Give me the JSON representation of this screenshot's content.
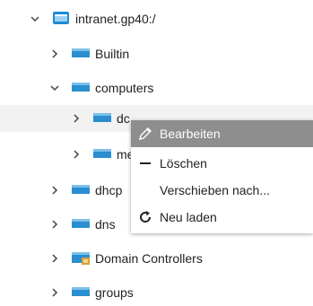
{
  "tree": {
    "root": {
      "label": "intranet.gp40:/",
      "icon": "server-icon"
    },
    "items": [
      {
        "label": "Builtin",
        "icon": "folder-icon"
      },
      {
        "label": "computers",
        "icon": "folder-icon"
      },
      {
        "label": "dc",
        "icon": "folder-icon"
      },
      {
        "label": "me",
        "icon": "folder-icon"
      },
      {
        "label": "dhcp",
        "icon": "folder-icon"
      },
      {
        "label": "dns",
        "icon": "folder-icon"
      },
      {
        "label": "Domain Controllers",
        "icon": "ou-folder-icon"
      },
      {
        "label": "groups",
        "icon": "folder-icon"
      }
    ]
  },
  "context_menu": {
    "items": [
      {
        "label": "Bearbeiten",
        "icon": "pencil-icon"
      },
      {
        "label": "Löschen",
        "icon": "minus-icon"
      },
      {
        "label": "Verschieben nach...",
        "icon": ""
      },
      {
        "label": "Neu laden",
        "icon": "reload-icon"
      }
    ]
  },
  "colors": {
    "folder": "#2a8ed0",
    "menu_highlight": "#8e8e8e",
    "selected_row": "#f2f2f2"
  }
}
